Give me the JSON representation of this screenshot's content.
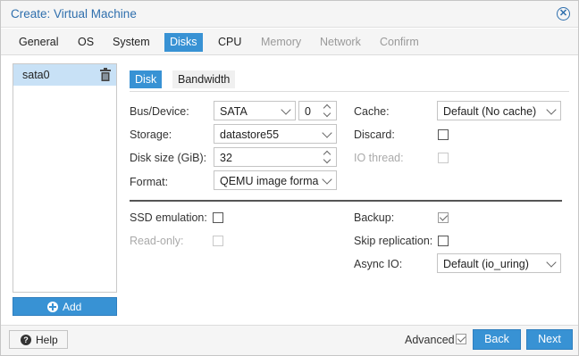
{
  "window": {
    "title": "Create: Virtual Machine",
    "close_icon": "close-circle-icon"
  },
  "tabs": [
    {
      "label": "General",
      "state": "normal"
    },
    {
      "label": "OS",
      "state": "normal"
    },
    {
      "label": "System",
      "state": "normal"
    },
    {
      "label": "Disks",
      "state": "active"
    },
    {
      "label": "CPU",
      "state": "normal"
    },
    {
      "label": "Memory",
      "state": "disabled"
    },
    {
      "label": "Network",
      "state": "disabled"
    },
    {
      "label": "Confirm",
      "state": "disabled"
    }
  ],
  "disk_list": {
    "items": [
      {
        "label": "sata0",
        "icon": "trash-icon"
      }
    ],
    "add_label": "Add"
  },
  "subtabs": [
    {
      "label": "Disk",
      "state": "active"
    },
    {
      "label": "Bandwidth",
      "state": "inactive"
    }
  ],
  "form": {
    "bus_device": {
      "label": "Bus/Device:",
      "bus": "SATA",
      "device": "0"
    },
    "storage": {
      "label": "Storage:",
      "value": "datastore55"
    },
    "disk_size": {
      "label": "Disk size (GiB):",
      "value": "32"
    },
    "format": {
      "label": "Format:",
      "value": "QEMU image forma"
    },
    "cache": {
      "label": "Cache:",
      "value": "Default (No cache)"
    },
    "discard": {
      "label": "Discard:",
      "checked": false
    },
    "io_thread": {
      "label": "IO thread:",
      "checked": false,
      "disabled": true
    },
    "ssd_emulation": {
      "label": "SSD emulation:",
      "checked": false
    },
    "read_only": {
      "label": "Read-only:",
      "checked": false,
      "disabled": true
    },
    "backup": {
      "label": "Backup:",
      "checked": true
    },
    "skip_replication": {
      "label": "Skip replication:",
      "checked": false
    },
    "async_io": {
      "label": "Async IO:",
      "value": "Default (io_uring)"
    }
  },
  "footer": {
    "help_label": "Help",
    "advanced_label": "Advanced",
    "advanced_checked": true,
    "back_label": "Back",
    "next_label": "Next"
  },
  "colors": {
    "accent": "#3892d4",
    "title": "#2f6fad"
  }
}
